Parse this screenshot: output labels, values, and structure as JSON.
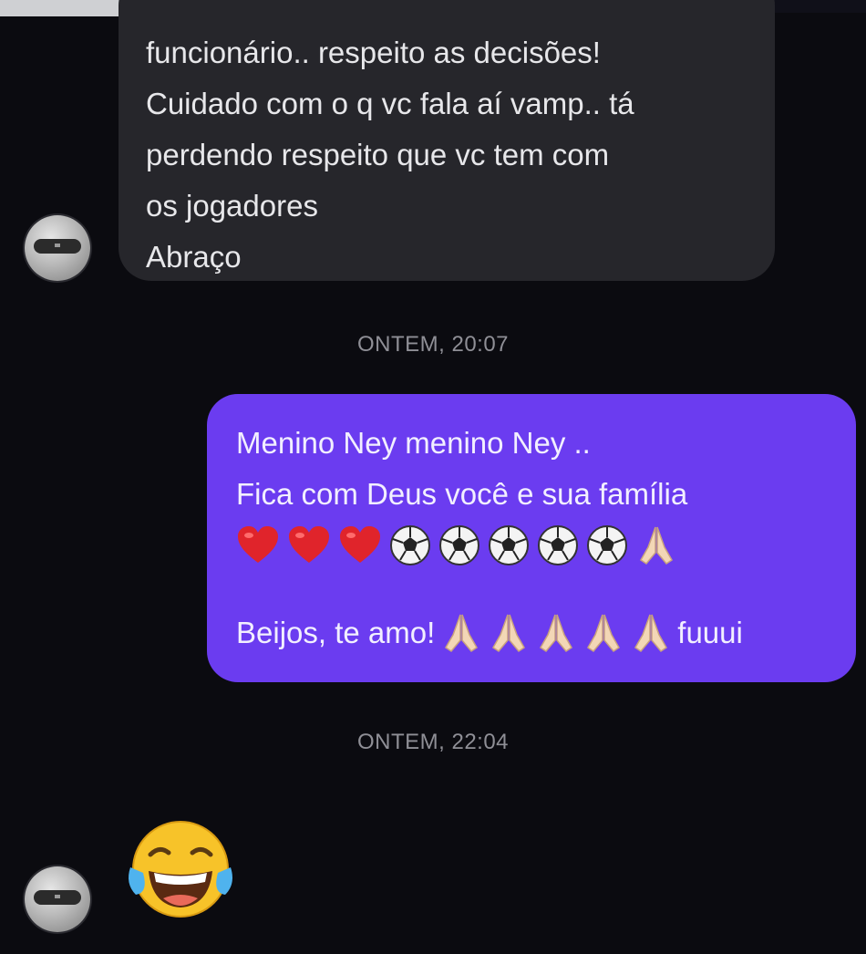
{
  "incoming_message": {
    "lines": [
      "funcionário.. respeito as decisões!",
      "Cuidado com o q vc fala aí vamp.. tá",
      "perdendo respeito que vc tem com",
      "os jogadores",
      "Abraço"
    ]
  },
  "timestamps": [
    "ONTEM, 20:07",
    "ONTEM, 22:04"
  ],
  "outgoing_message": {
    "line1": "Menino Ney menino Ney ..",
    "line2": "Fica com Deus você e sua família",
    "emoji_row": [
      "red-heart",
      "red-heart",
      "red-heart",
      "soccer-ball",
      "soccer-ball",
      "soccer-ball",
      "soccer-ball",
      "soccer-ball",
      "folded-hands"
    ],
    "line4_text": "Beijos, te amo!",
    "line4_emoji": [
      "folded-hands",
      "folded-hands",
      "folded-hands",
      "folded-hands",
      "folded-hands"
    ],
    "line4_suffix": "fuuui"
  },
  "last_message": {
    "emoji": "face-with-tears-of-joy"
  },
  "colors": {
    "background": "#0b0b10",
    "incoming_bubble": "#26262b",
    "outgoing_bubble": "#6b3cf0",
    "timestamp": "#8f8f96"
  }
}
